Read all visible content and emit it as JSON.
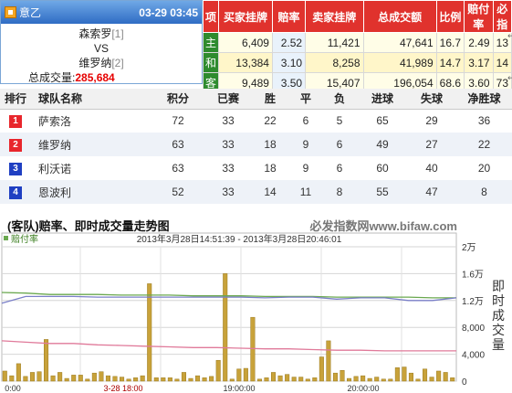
{
  "match": {
    "league": "意乙",
    "datetime": "03-29 03:45",
    "home_team": "森索罗",
    "home_rank": "[1]",
    "vs": "VS",
    "away_team": "维罗纳",
    "away_rank": "[2]",
    "total_label": "总成交量:",
    "total_value": "285,684"
  },
  "odds": {
    "headers": [
      "项",
      "买家挂牌",
      "赔率",
      "卖家挂牌",
      "总成交额",
      "比例",
      "赔付率",
      "必指"
    ],
    "rows": [
      {
        "tag": "主",
        "buy": "6,409",
        "rate": "2.52",
        "sell": "11,421",
        "volume": "47,641",
        "ratio": "16.7",
        "payout": "2.49",
        "index": "13"
      },
      {
        "tag": "和",
        "buy": "13,384",
        "rate": "3.10",
        "sell": "8,258",
        "volume": "41,989",
        "ratio": "14.7",
        "payout": "3.17",
        "index": "14"
      },
      {
        "tag": "客",
        "buy": "9,489",
        "rate": "3.50",
        "sell": "15,407",
        "volume": "196,054",
        "ratio": "68.6",
        "payout": "3.60",
        "index": "73"
      }
    ],
    "colors": {
      "header": "#e0322d",
      "tag": "#2e8b2e"
    }
  },
  "standings": {
    "headers": [
      "排行",
      "球队名称",
      "积分",
      "已赛",
      "胜",
      "平",
      "负",
      "进球",
      "失球",
      "净胜球"
    ],
    "rows": [
      {
        "rank": "1",
        "team": "萨索洛",
        "points": "72",
        "played": "33",
        "won": "22",
        "draw": "6",
        "lost": "5",
        "gf": "65",
        "ga": "29",
        "gd": "36",
        "color": "#e8262c"
      },
      {
        "rank": "2",
        "team": "维罗纳",
        "points": "63",
        "played": "33",
        "won": "18",
        "draw": "9",
        "lost": "6",
        "gf": "49",
        "ga": "27",
        "gd": "22",
        "color": "#e8262c"
      },
      {
        "rank": "3",
        "team": "利沃诺",
        "points": "63",
        "played": "33",
        "won": "18",
        "draw": "9",
        "lost": "6",
        "gf": "60",
        "ga": "40",
        "gd": "20",
        "color": "#1f3fc2"
      },
      {
        "rank": "4",
        "team": "恩波利",
        "points": "52",
        "played": "33",
        "won": "14",
        "draw": "11",
        "lost": "8",
        "gf": "55",
        "ga": "47",
        "gd": "8",
        "color": "#1f3fc2"
      }
    ]
  },
  "chart_header": {
    "title": "(客队)赔率、即时成交量走势图",
    "brand": "必发指数网www.bifaw.com"
  },
  "chart_data": {
    "type": "line",
    "legend": "赔付率",
    "period": "2013年3月28日14:51:39 - 2013年3月28日20:46:01",
    "y_right_label": "即时成交量",
    "y_ticks": [
      "2万",
      "1.6万",
      "1.2万",
      "8,000",
      "4,000",
      "0"
    ],
    "y_range": [
      0,
      20000
    ],
    "x_ticks": [
      "0:00",
      "3-28 18:00",
      "19:00:00",
      "20:00:00"
    ],
    "series": [
      {
        "color": "#6aa84f",
        "values": [
          13.2,
          13.1,
          12.9,
          12.9,
          12.9,
          12.8,
          12.8,
          12.8,
          12.7,
          12.7,
          12.7,
          12.6,
          12.6,
          12.6,
          12.5,
          12.5,
          12.5,
          12.5,
          12.4,
          12.4
        ]
      },
      {
        "color": "#7a7fc8",
        "values": [
          11.6,
          12.6,
          12.6,
          12.6,
          12.5,
          12.5,
          12.5,
          12.5,
          12.5,
          12.5,
          12.5,
          12.4,
          12.5,
          12.5,
          12.2,
          12.4,
          12.4,
          12.0,
          12.0,
          12.4
        ]
      },
      {
        "color": "#e07a9a",
        "values": [
          6.0,
          5.8,
          5.6,
          5.6,
          5.4,
          5.3,
          5.2,
          5.1,
          5.0,
          5.0,
          4.9,
          4.8,
          4.8,
          4.7,
          4.6,
          4.6,
          4.5,
          4.5,
          4.5,
          4.5
        ]
      }
    ],
    "bars": [
      1500,
      800,
      2600,
      700,
      1300,
      1400,
      6200,
      800,
      1300,
      400,
      900,
      900,
      300,
      1200,
      1400,
      800,
      700,
      600,
      300,
      500,
      800,
      14500,
      500,
      500,
      500,
      300,
      1300,
      400,
      800,
      500,
      700,
      3100,
      16000,
      300,
      1800,
      1900,
      9500,
      300,
      500,
      1300,
      800,
      1000,
      600,
      600,
      300,
      500,
      3600,
      6000,
      1200,
      1600,
      400,
      700,
      800,
      400,
      600,
      300,
      300,
      2000,
      2100,
      1200,
      300,
      1800,
      600,
      1500,
      1300,
      500
    ],
    "bar_color": "#c8a23a"
  }
}
